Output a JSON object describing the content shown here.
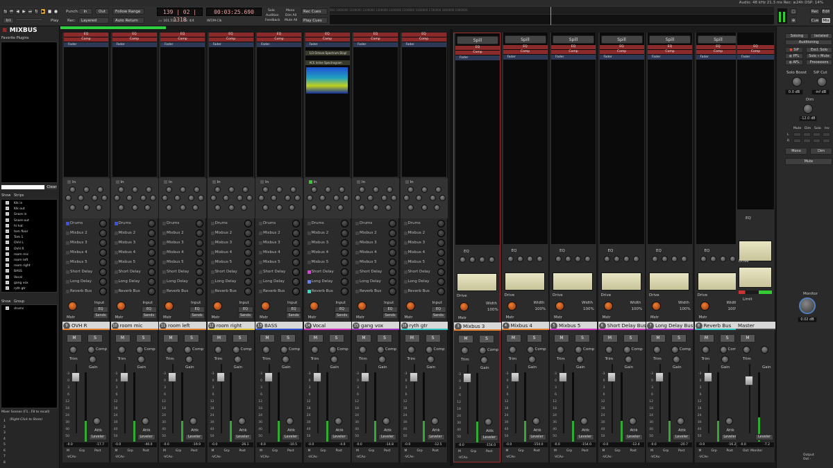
{
  "status_bar": "Audio: 48 kHz 21.3 ms  Rec: ≥24h  DSP: 14%",
  "toolbar": {
    "int": "Int",
    "play": "Play",
    "punch_label": "Punch:",
    "punch_in": "In",
    "punch_out": "Out",
    "rec_label": "Rec:",
    "rec_mode": "Layered",
    "follow_range": "Follow Range",
    "auto_return": "Auto Return",
    "bbt_clock": "139 | 02 | 1318",
    "timecode_clock": "00:03:25.690",
    "tempo": "♩= 161.510",
    "meter": "TS: 4/4",
    "sync": "INT/M-Clk",
    "solo": "Solo",
    "audition": "Audition",
    "feedback": "Feedback",
    "mono": "Mono",
    "dim_all": "Dim All",
    "mute_all": "Mute All",
    "rec_cues": "Rec Cues",
    "play_cues": "Play Cues",
    "ruler_ticks": "900 1000000 1100000 1200000 1300000 1400000 1500000 1600000 1700000 1800000 1900000",
    "rec": "Rec",
    "edit": "Edit",
    "cue": "Cue",
    "mix": "Mix"
  },
  "left_panel": {
    "logo_mark": "≋",
    "logo_text": "MIXBUS",
    "favorite_plugins": "Favorite Plugins",
    "clear": "Clear",
    "show": "Show",
    "strips_header": "Strips",
    "strips": [
      "Klk in",
      "Klk out",
      "Snare in",
      "Snare out",
      "hi hat",
      "tom floor",
      "Tom 1",
      "OVH L",
      "OVH R",
      "room mic",
      "room left",
      "room right",
      "BASS",
      "Vocal",
      "gang vox",
      "ryth gtr"
    ],
    "group_show": "Show",
    "group_header": "Group",
    "groups": [
      "drums"
    ],
    "mixer_scenes": "Mixer Scenes (F1...F8 to recall)",
    "scene_hint": "(Right-Click to Store)",
    "scene_numbers": [
      "1",
      "2",
      "3",
      "4",
      "5",
      "6",
      "7",
      "8"
    ]
  },
  "input_strips": [
    {
      "num": "9",
      "name": "OVH R",
      "color": "#e08030",
      "sends_on": [
        true,
        false,
        false,
        false,
        false,
        false,
        false,
        false
      ],
      "in_led": false,
      "peak": "-0.0",
      "level": "-17.7",
      "vca_value": "drums",
      "grp": "Ø"
    },
    {
      "num": "10",
      "name": "room mic",
      "color": "#e08030",
      "sends_on": [
        true,
        false,
        false,
        false,
        false,
        false,
        false,
        false
      ],
      "in_led": false,
      "peak": "-0.0",
      "level": "-40.0",
      "vca_value": "drums",
      "grp": "Ø"
    },
    {
      "num": "11",
      "name": "room left",
      "color": "#e08030",
      "sends_on": [
        false,
        false,
        false,
        false,
        false,
        false,
        false,
        false
      ],
      "in_led": false,
      "peak": "-0.0",
      "level": "-19.9",
      "vca_value": "",
      "grp": "Ø"
    },
    {
      "num": "12",
      "name": "room right",
      "color": "#e0c030",
      "sends_on": [
        false,
        false,
        false,
        false,
        false,
        false,
        false,
        false
      ],
      "in_led": false,
      "peak": "-0.0",
      "level": "-26.1",
      "vca_value": "",
      "grp": "Ø"
    },
    {
      "num": "13",
      "name": "BASS",
      "color": "#3050d0",
      "sends_on": [
        false,
        false,
        false,
        false,
        false,
        false,
        false,
        false
      ],
      "in_led": false,
      "peak": "-0.0",
      "level": "-10.5",
      "vca_value": "",
      "grp": "Ø"
    },
    {
      "num": "14",
      "name": "Vocal",
      "color": "#d030c0",
      "sends_on": [
        false,
        false,
        false,
        false,
        false,
        true,
        true,
        true
      ],
      "in_led": true,
      "peak": "-0.0",
      "level": "-4.0",
      "vca_value": "",
      "grp": "Ø"
    },
    {
      "num": "15",
      "name": "gang vox",
      "color": "#a030c0",
      "sends_on": [
        false,
        false,
        false,
        false,
        false,
        false,
        false,
        false
      ],
      "in_led": false,
      "peak": "-0.0",
      "level": "-14.8",
      "vca_value": "",
      "grp": "Ø"
    },
    {
      "num": "16",
      "name": "ryth gtr",
      "color": "#30c0c0",
      "sends_on": [
        false,
        false,
        false,
        false,
        false,
        false,
        false,
        false
      ],
      "in_led": false,
      "peak": "-0.0",
      "level": "-12.5",
      "vca_value": "",
      "grp": "Ø"
    }
  ],
  "send_labels": [
    "Drums",
    "Mixbus 2",
    "Mixbus 3",
    "Mixbus 4",
    "Mixbus 5",
    "Short Delay",
    "Long Delay",
    "Reverb Bus"
  ],
  "strip_labels": {
    "eq": "EQ",
    "comp": "Comp",
    "fader": "Fader",
    "in": "In",
    "input": "Input",
    "eq_btn": "EQ",
    "sends": "Sends",
    "mstr": "Mstr",
    "m": "M",
    "s": "S",
    "trim": "Trim",
    "comp_lbl": "Comp",
    "gain": "Gain",
    "attk": "Attk",
    "ratio": "Ratio",
    "leveler": "Leveler",
    "compressor": "Compr",
    "grp": "Grp",
    "post": "Post",
    "vcas": "-VCAs-",
    "spill": "Spill",
    "drive": "Drive",
    "width": "Width",
    "width_val": "100%",
    "monitor": "Monitor >",
    "limit": "Limit",
    "master": "Master"
  },
  "plugins_vocal": [
    "1/3 Octave Spectrum Displ",
    "ACE Inline Spectrogram"
  ],
  "meter_scale": [
    "-3",
    "0",
    "3",
    "6",
    "12",
    "18",
    "24",
    "30",
    "40",
    "50"
  ],
  "buses": [
    {
      "num": "3",
      "name": "Mixbus 3",
      "color": "#e08030",
      "peak": "-0.0",
      "level": "-154.0"
    },
    {
      "num": "4",
      "name": "Mixbus 4",
      "color": "#e08030",
      "peak": "-0.0",
      "level": "-154.0"
    },
    {
      "num": "5",
      "name": "Mixbus 5",
      "color": "#d030c0",
      "peak": "-0.0",
      "level": "-154.0"
    },
    {
      "num": "6",
      "name": "Short Delay Bus",
      "color": "#d030c0",
      "peak": "-0.0",
      "level": "-12.4"
    },
    {
      "num": "7",
      "name": "Long Delay Bus",
      "color": "#a030c0",
      "peak": "-0.0",
      "level": "-20.7"
    },
    {
      "num": "8",
      "name": "Reverb Bus",
      "color": "#30c0c0",
      "peak": "-0.0",
      "level": "-16.2"
    }
  ],
  "master": {
    "name": "Master",
    "peak": "-0.0",
    "level": "-7.2",
    "output": "Out: Monitor"
  },
  "monitor_panel": {
    "soloing": "Soloing",
    "isolated": "Isolated",
    "auditioning": "Auditioning",
    "sip": "SiP",
    "excl_solo": "Excl. Solo",
    "pfl": "PFL",
    "solo_mute": "Solo » Mute",
    "afl": "AFL",
    "processors": "Processors",
    "solo_boost": "Solo Boost",
    "sip_cut": "SiP Cut",
    "boost_val": "0.0 dB",
    "cut_val": "-inf dB",
    "dim": "Dim",
    "dim_val": "-12.0 dB",
    "mute": "Mute",
    "dim_col": "Dim",
    "solo": "Solo",
    "inv": "Inv",
    "l": "L",
    "r": "R",
    "mono_btn": "Mono",
    "dim_btn": "Dim",
    "mute_btn": "Mute",
    "monitor": "Monitor",
    "monitor_val": "0.02 dB",
    "output": "Output",
    "output_val": "Out -"
  }
}
